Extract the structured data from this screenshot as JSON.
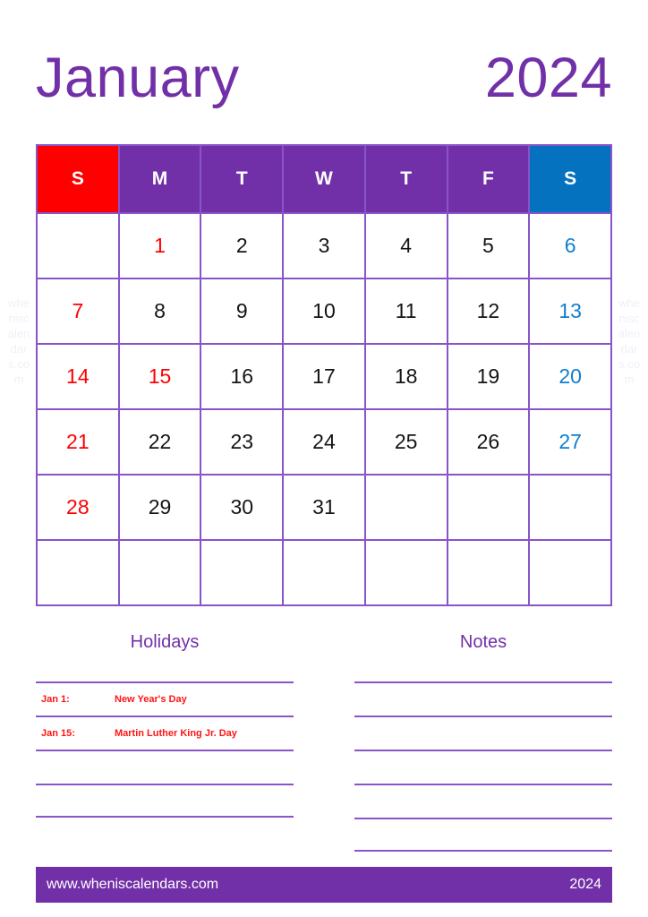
{
  "title": {
    "month": "January",
    "year": "2024"
  },
  "colors": {
    "purple": "#7230a8",
    "grid_purple": "#8854c8",
    "sunday_red": "#ff0000",
    "saturday_blue": "#0572c0",
    "holiday_red": "#ff1414",
    "day_text": "#141414",
    "white": "#ffffff"
  },
  "watermark": "wheniscalendars.com",
  "calendar": {
    "weekday_headers": [
      {
        "label": "S",
        "kind": "sunday"
      },
      {
        "label": "M",
        "kind": "weekday"
      },
      {
        "label": "T",
        "kind": "weekday"
      },
      {
        "label": "W",
        "kind": "weekday"
      },
      {
        "label": "T",
        "kind": "weekday"
      },
      {
        "label": "F",
        "kind": "weekday"
      },
      {
        "label": "S",
        "kind": "saturday"
      }
    ],
    "weeks": [
      [
        {
          "day": "",
          "kind": "empty"
        },
        {
          "day": "1",
          "kind": "holiday"
        },
        {
          "day": "2",
          "kind": "normal"
        },
        {
          "day": "3",
          "kind": "normal"
        },
        {
          "day": "4",
          "kind": "normal"
        },
        {
          "day": "5",
          "kind": "normal"
        },
        {
          "day": "6",
          "kind": "saturday"
        }
      ],
      [
        {
          "day": "7",
          "kind": "sunday"
        },
        {
          "day": "8",
          "kind": "normal"
        },
        {
          "day": "9",
          "kind": "normal"
        },
        {
          "day": "10",
          "kind": "normal"
        },
        {
          "day": "11",
          "kind": "normal"
        },
        {
          "day": "12",
          "kind": "normal"
        },
        {
          "day": "13",
          "kind": "saturday"
        }
      ],
      [
        {
          "day": "14",
          "kind": "sunday"
        },
        {
          "day": "15",
          "kind": "holiday"
        },
        {
          "day": "16",
          "kind": "normal"
        },
        {
          "day": "17",
          "kind": "normal"
        },
        {
          "day": "18",
          "kind": "normal"
        },
        {
          "day": "19",
          "kind": "normal"
        },
        {
          "day": "20",
          "kind": "saturday"
        }
      ],
      [
        {
          "day": "21",
          "kind": "sunday"
        },
        {
          "day": "22",
          "kind": "normal"
        },
        {
          "day": "23",
          "kind": "normal"
        },
        {
          "day": "24",
          "kind": "normal"
        },
        {
          "day": "25",
          "kind": "normal"
        },
        {
          "day": "26",
          "kind": "normal"
        },
        {
          "day": "27",
          "kind": "saturday"
        }
      ],
      [
        {
          "day": "28",
          "kind": "sunday"
        },
        {
          "day": "29",
          "kind": "normal"
        },
        {
          "day": "30",
          "kind": "normal"
        },
        {
          "day": "31",
          "kind": "normal"
        },
        {
          "day": "",
          "kind": "empty"
        },
        {
          "day": "",
          "kind": "empty"
        },
        {
          "day": "",
          "kind": "empty"
        }
      ],
      [
        {
          "day": "",
          "kind": "empty"
        },
        {
          "day": "",
          "kind": "empty"
        },
        {
          "day": "",
          "kind": "empty"
        },
        {
          "day": "",
          "kind": "empty"
        },
        {
          "day": "",
          "kind": "empty"
        },
        {
          "day": "",
          "kind": "empty"
        },
        {
          "day": "",
          "kind": "empty"
        }
      ]
    ]
  },
  "holidays_panel": {
    "title": "Holidays",
    "rows": [
      {
        "date": "Jan 1:",
        "name": "New Year's Day"
      },
      {
        "date": "Jan 15:",
        "name": "Martin Luther King Jr. Day"
      },
      {
        "date": "",
        "name": ""
      },
      {
        "date": "",
        "name": ""
      }
    ]
  },
  "notes_panel": {
    "title": "Notes",
    "rows": [
      {
        "text": ""
      },
      {
        "text": ""
      },
      {
        "text": ""
      },
      {
        "text": ""
      },
      {
        "text": ""
      }
    ]
  },
  "footer": {
    "url": "www.wheniscalendars.com",
    "year": "2024"
  }
}
